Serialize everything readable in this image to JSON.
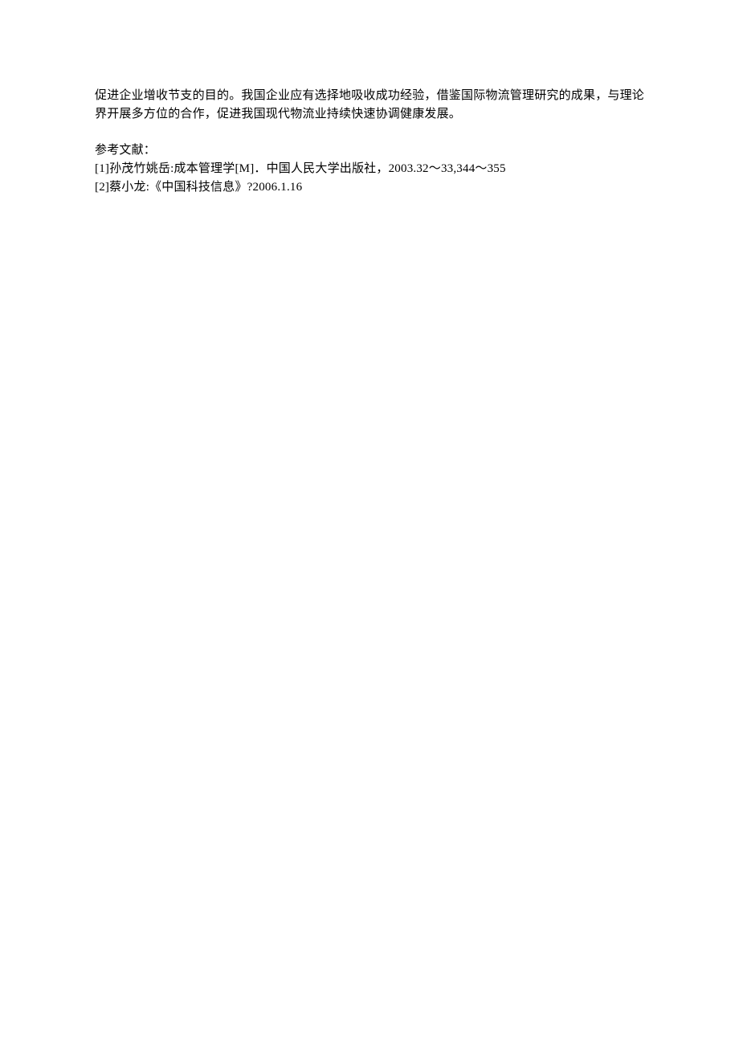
{
  "body": {
    "paragraph": "促进企业增收节支的目的。我国企业应有选择地吸收成功经验，借鉴国际物流管理研究的成果，与理论界开展多方位的合作，促进我国现代物流业持续快速协调健康发展。"
  },
  "references": {
    "heading": "参考文献：",
    "items": [
      "[1]孙茂竹姚岳:成本管理学[M]．中国人民大学出版社，2003.32～33,344～355",
      "[2]蔡小龙:《中国科技信息》?2006.1.16"
    ]
  }
}
